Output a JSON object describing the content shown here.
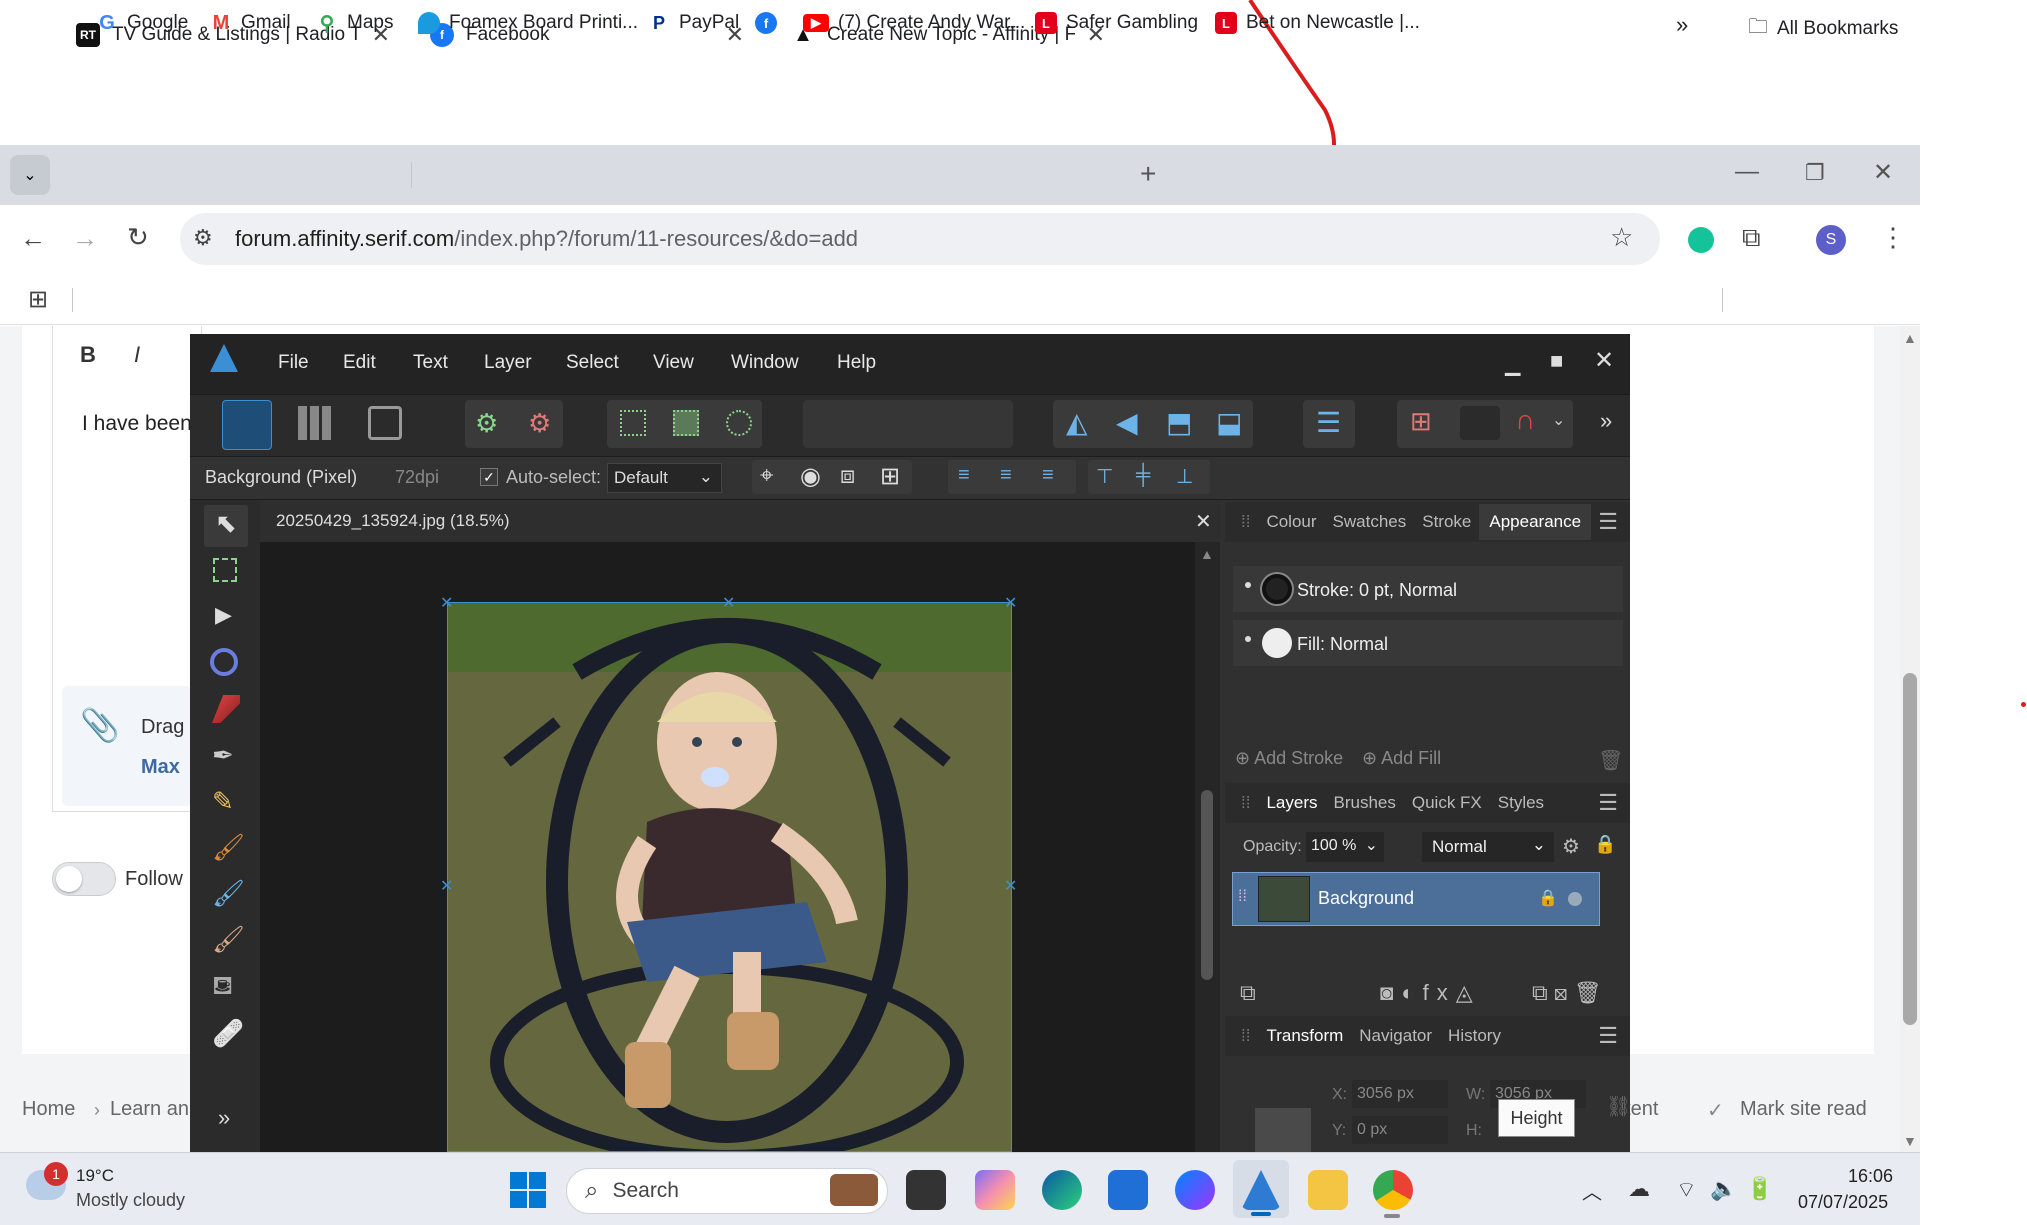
{
  "browser": {
    "tabs": [
      {
        "title": "TV Guide & Listings | Radio Tim",
        "favicon": "RT"
      },
      {
        "title": "Facebook",
        "favicon": "f"
      },
      {
        "title": "Create New Topic - Affinity | For",
        "favicon": "A",
        "active": true
      }
    ],
    "url_domain": "forum.affinity.serif.com",
    "url_path": "/index.php?/forum/11-resources/&do=add",
    "profile_initial": "S",
    "bookmarks": [
      "Google",
      "Gmail",
      "Maps",
      "Foamex Board Printi...",
      "PayPal",
      "",
      "(7) Create Andy War...",
      "Safer Gambling",
      "Bet on Newcastle |..."
    ],
    "all_bookmarks": "All Bookmarks",
    "more": "»"
  },
  "forum": {
    "bold": "B",
    "italic": "I",
    "body_text": "I have been",
    "drag_text": "Drag",
    "max_text": "Max",
    "follow_label": "Follow",
    "footer": {
      "home": "Home",
      "learn": "Learn an",
      "content": "ntent",
      "mark_read": "Mark site read"
    }
  },
  "affinity": {
    "menu": [
      "File",
      "Edit",
      "Text",
      "Layer",
      "Select",
      "View",
      "Window",
      "Help"
    ],
    "context": {
      "layer_name": "Background (Pixel)",
      "dpi": "72dpi",
      "auto_select": "Auto-select:",
      "auto_select_value": "Default"
    },
    "document_tab": "20250429_135924.jpg (18.5%)",
    "top_panel_tabs": [
      "Colour",
      "Swatches",
      "Stroke",
      "Appearance"
    ],
    "stroke_label": "Stroke: 0 pt,  Normal",
    "fill_label": "Fill:  Normal",
    "add_stroke": "Add Stroke",
    "add_fill": "Add Fill",
    "layer_panel_tabs": [
      "Layers",
      "Brushes",
      "Quick FX",
      "Styles"
    ],
    "opacity_label": "Opacity:",
    "opacity_value": "100 %",
    "blend_mode": "Normal",
    "layer_item": "Background",
    "transform_tabs": [
      "Transform",
      "Navigator",
      "History"
    ],
    "transform": {
      "x_label": "X:",
      "x_value": "3056 px",
      "y_label": "Y:",
      "y_value": "0 px",
      "w_label": "W:",
      "w_value": "3056 px",
      "h_label": "H:"
    },
    "tooltip": "Height",
    "expand": "»"
  },
  "taskbar": {
    "weather_temp": "19°C",
    "weather_desc": "Mostly cloudy",
    "weather_badge": "1",
    "search_label": "Search",
    "time": "16:06",
    "date": "07/07/2025"
  },
  "colors": {
    "chrome_tabbar": "#d9dde3",
    "affinity_bg": "#303030",
    "layer_selected": "#4c6f9a",
    "annotation_red": "#d91d1d"
  }
}
